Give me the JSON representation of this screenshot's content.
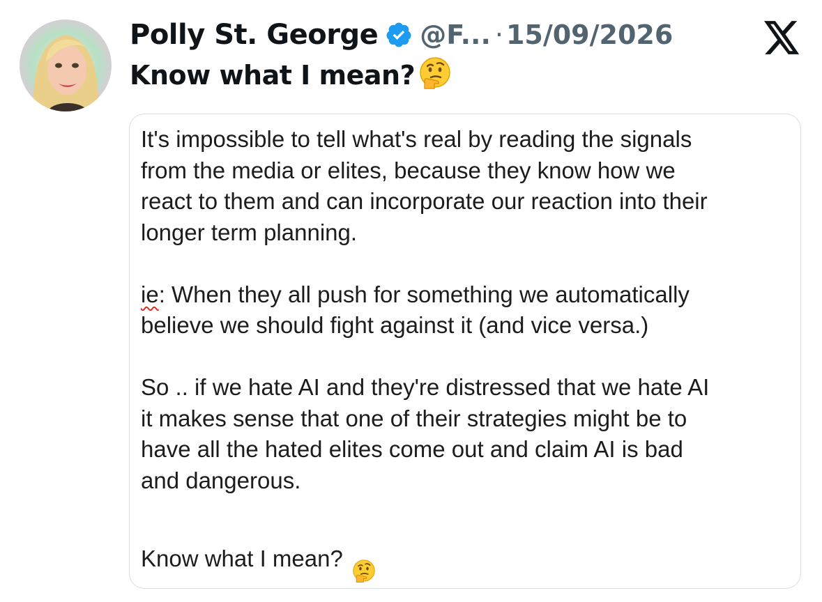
{
  "author": {
    "name": "Polly St. George",
    "handle": "@F...",
    "separator": "·",
    "date": "15/09/2026"
  },
  "icons": {
    "verified": "verified-badge-icon",
    "platform": "x-logo-icon",
    "emoji": "thinking-face-emoji"
  },
  "colors": {
    "verified": "#1d9bf0",
    "muted": "#536471",
    "text": "#0f1419",
    "border": "#d9dfe3",
    "spellcheck": "#d93025"
  },
  "tweet": {
    "text": "Know what I mean?"
  },
  "card": {
    "p1": "It's impossible to tell what's real by reading the signals\nfrom the media or elites, because they know how we\nreact to them and can incorporate our reaction into their\nlonger term planning.",
    "p2_flag": "ie",
    "p2_rest": ": When they all push for something we automatically\nbelieve we should fight against it (and vice versa.)",
    "p3": "So .. if we hate AI and they're distressed that we hate AI\nit makes sense that one of their strategies might be to\nhave all the hated elites come out and claim AI is bad\nand dangerous.",
    "p4": "Know what I mean?"
  }
}
